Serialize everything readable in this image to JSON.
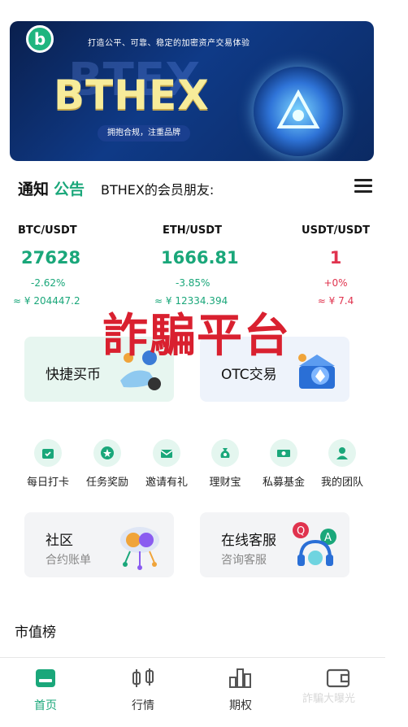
{
  "banner": {
    "logo_letter": "b",
    "tagline": "打造公平、可靠、稳定的加密资产交易体验",
    "bg_word": "BTEX",
    "brand": "BTHEX",
    "pill": "拥抱合规，注重品牌"
  },
  "notice": {
    "label_part1": "通知",
    "label_part2": "公告",
    "text": "BTHEX的会员朋友:",
    "label_color": "#1aa77a"
  },
  "tickers": [
    {
      "pair": "BTC/USDT",
      "price": "27628",
      "change": "-2.62%",
      "cny": "≈ ¥ 204447.2"
    },
    {
      "pair": "ETH/USDT",
      "price": "1666.81",
      "change": "-3.85%",
      "cny": "≈ ¥ 12334.394"
    },
    {
      "pair": "USDT/USDT",
      "price": "1",
      "change": "+0%",
      "cny": "≈ ¥ 7.4"
    }
  ],
  "colors": {
    "green": "#1aa77a",
    "red": "#e0334e",
    "overlay_red": "#d9202f"
  },
  "overlay": {
    "text": "詐騙平台"
  },
  "quick_cards": [
    {
      "label": "快捷买币",
      "icon": "coin-hand-icon"
    },
    {
      "label": "OTC交易",
      "icon": "crypto-box-icon"
    }
  ],
  "grid": [
    {
      "label": "每日打卡",
      "icon": "calendar-check-icon"
    },
    {
      "label": "任务奖励",
      "icon": "star-badge-icon"
    },
    {
      "label": "邀请有礼",
      "icon": "envelope-icon"
    },
    {
      "label": "理财宝",
      "icon": "money-bag-icon"
    },
    {
      "label": "私募基金",
      "icon": "cash-icon"
    },
    {
      "label": "我的团队",
      "icon": "person-icon"
    }
  ],
  "info_cards": [
    {
      "title": "社区",
      "sub": "合约账单",
      "icon": "coin-cloud-icon"
    },
    {
      "title": "在线客服",
      "sub": "咨询客服",
      "icon": "headset-qa-icon"
    }
  ],
  "section": {
    "title": "市值榜"
  },
  "nav": [
    {
      "label": "首页",
      "icon": "home-icon",
      "active": true
    },
    {
      "label": "行情",
      "icon": "candlestick-icon",
      "active": false
    },
    {
      "label": "期权",
      "icon": "bar-chart-icon",
      "active": false
    },
    {
      "label": "",
      "icon": "wallet-icon",
      "active": false
    }
  ],
  "watermark": {
    "text": "詐騙大曝光"
  }
}
